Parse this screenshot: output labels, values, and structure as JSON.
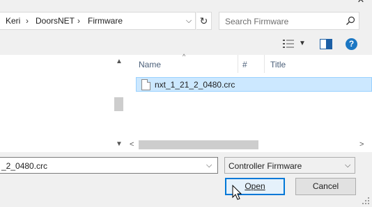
{
  "window": {
    "close_glyph": "✕"
  },
  "address": {
    "breadcrumbs": [
      "Keri",
      "DoorsNET",
      "Firmware"
    ],
    "separator": "›",
    "dropdown_glyph": "⌵",
    "refresh_glyph": "↻"
  },
  "search": {
    "placeholder": "Search Firmware",
    "icon": "search-icon"
  },
  "toolbar": {
    "view_icon": "details-view-icon",
    "view_dropdown_glyph": "▼",
    "preview_icon": "preview-pane-icon",
    "help_label": "?"
  },
  "files": {
    "columns": [
      "Name",
      "#",
      "Title"
    ],
    "sort_glyph": "^",
    "rows": [
      {
        "name": "nxt_1_21_2_0480.crc",
        "selected": true
      }
    ]
  },
  "scrollbars": {
    "up": "▲",
    "down": "▼",
    "left": "<",
    "right": ">"
  },
  "bottom": {
    "file_name_value": "_2_0480.crc",
    "file_name_dropdown": "⌵",
    "filter_value": "Controller Firmware",
    "filter_dropdown": "⌵",
    "open_label": "Open",
    "cancel_label": "Cancel"
  },
  "colors": {
    "selection_bg": "#cce8ff",
    "selection_border": "#99d1ff",
    "accent": "#0078d7",
    "help_blue": "#1c77c3"
  }
}
